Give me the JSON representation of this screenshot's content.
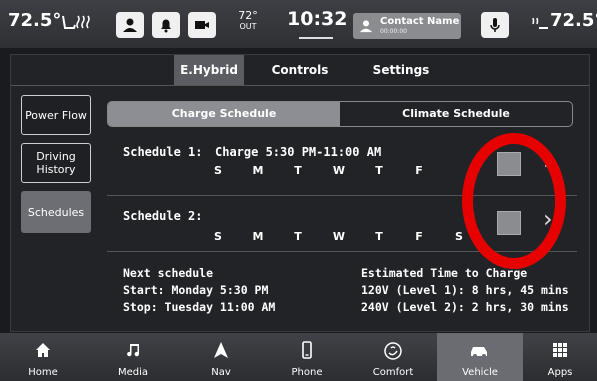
{
  "topbar": {
    "left_temp": "72.5°",
    "outside_temp": "72°",
    "outside_label": "OUT",
    "clock": "10:32",
    "contact_name": "Contact Name",
    "contact_time": "00:00:00",
    "right_temp": "72.5°"
  },
  "tabs": [
    {
      "label": "E.Hybrid",
      "active": true
    },
    {
      "label": "Controls",
      "active": false
    },
    {
      "label": "Settings",
      "active": false
    }
  ],
  "sidebar": {
    "items": [
      {
        "label": "Power Flow"
      },
      {
        "label": "Driving History"
      },
      {
        "label": "Schedules",
        "active": true
      }
    ]
  },
  "segment": {
    "charge": "Charge Schedule",
    "climate": "Climate Schedule"
  },
  "schedule1": {
    "label": "Schedule 1:",
    "detail": "Charge 5:30 PM-11:00 AM",
    "days": [
      "S",
      "M",
      "T",
      "W",
      "T",
      "F"
    ]
  },
  "schedule2": {
    "label": "Schedule 2:",
    "days": [
      "S",
      "M",
      "T",
      "W",
      "T",
      "F",
      "S"
    ]
  },
  "next": {
    "heading": "Next schedule",
    "start": "Start: Monday 5:30 PM",
    "stop": "Stop: Tuesday 11:00 AM"
  },
  "estimate": {
    "heading": "Estimated Time to Charge",
    "level1": "120V (Level 1): 8 hrs, 45 mins",
    "level2": "240V (Level 2): 2 hrs, 30 mins"
  },
  "nav": [
    {
      "label": "Home",
      "icon": "home-icon"
    },
    {
      "label": "Media",
      "icon": "music-note-icon"
    },
    {
      "label": "Nav",
      "icon": "navigation-arrow-icon"
    },
    {
      "label": "Phone",
      "icon": "phone-icon"
    },
    {
      "label": "Comfort",
      "icon": "comfort-icon"
    },
    {
      "label": "Vehicle",
      "icon": "vehicle-icon",
      "active": true
    },
    {
      "label": "Apps",
      "icon": "apps-grid-icon"
    }
  ],
  "colors": {
    "highlight_ring": "#e60000",
    "active_gray": "#6a6c71"
  }
}
